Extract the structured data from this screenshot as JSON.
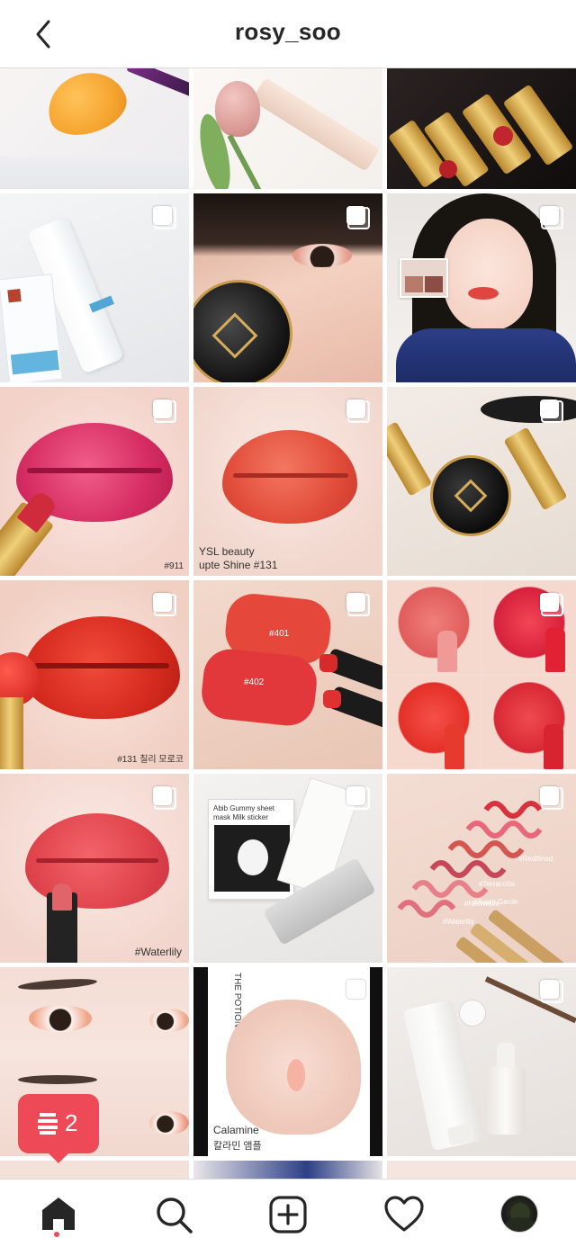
{
  "header": {
    "title": "rosy_soo"
  },
  "colors": {
    "accent": "#ed4956",
    "divider": "#dbdbdb",
    "text": "#262626"
  },
  "icons": {
    "back": "chevron-left-icon",
    "multi": "multiple-posts-icon",
    "home": "home-icon",
    "search": "search-icon",
    "create": "plus-square-icon",
    "activity": "heart-icon",
    "profile": "avatar"
  },
  "grid": {
    "posts": [
      {
        "caption": ""
      },
      {
        "caption": ""
      },
      {
        "caption": ""
      },
      {
        "caption": ""
      },
      {
        "caption": ""
      },
      {
        "caption": ""
      },
      {
        "caption": "#911"
      },
      {
        "caption": "YSL beauty"
      },
      {
        "caption": ""
      },
      {
        "caption": "#131 칠리 모로코"
      },
      {
        "caption": "#401"
      },
      {
        "caption": ""
      },
      {
        "caption": "#Waterlily"
      },
      {
        "caption": "Abib Gummy sheet mask Milk sticker"
      },
      {
        "caption": "#Redifined"
      },
      {
        "caption": ""
      },
      {
        "caption": "Calamine"
      },
      {
        "caption": ""
      }
    ],
    "extra_captions": {
      "swatch_402": "#402",
      "shine": "upte Shine #131",
      "calamine_kr": "칼라민 앰플",
      "potions": "THE POTIONS",
      "terracotta": "#Terracotta",
      "avant": "#Avant Garde",
      "newwave": "#Newwave",
      "waterlily2": "#Waterlily"
    }
  },
  "notification": {
    "count": "2"
  },
  "bottom_nav": {
    "items": [
      "home",
      "search",
      "create",
      "activity",
      "profile"
    ],
    "active": "home"
  }
}
